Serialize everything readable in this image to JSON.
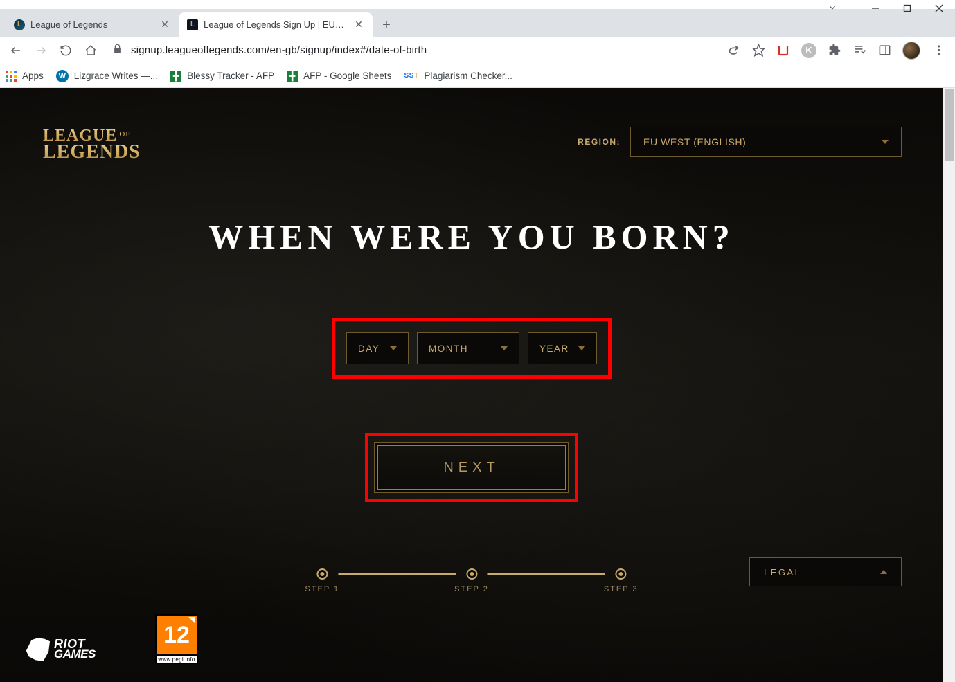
{
  "window": {
    "minimize": "–",
    "maximize": "□",
    "close": "✕",
    "caret": "⌄"
  },
  "tabs": {
    "items": [
      {
        "title": "League of Legends"
      },
      {
        "title": "League of Legends Sign Up | EU W"
      }
    ]
  },
  "address": {
    "url": "signup.leagueoflegends.com/en-gb/signup/index#/date-of-birth"
  },
  "bookmarks": {
    "apps": "Apps",
    "items": [
      {
        "label": "Lizgrace Writes —...",
        "icon": "wp"
      },
      {
        "label": "Blessy Tracker - AFP",
        "icon": "sheet"
      },
      {
        "label": "AFP - Google Sheets",
        "icon": "sheet"
      },
      {
        "label": "Plagiarism Checker...",
        "icon": "sst"
      }
    ]
  },
  "logo": {
    "line1": "LEAGUE",
    "of": "OF",
    "line2": "LEGENDS"
  },
  "region": {
    "label": "REGION:",
    "value": "EU WEST (ENGLISH)"
  },
  "headline": "WHEN WERE YOU BORN?",
  "dob": {
    "day": "DAY",
    "month": "MONTH",
    "year": "YEAR"
  },
  "next": "NEXT",
  "steps": {
    "s1": "STEP 1",
    "s2": "STEP 2",
    "s3": "STEP 3"
  },
  "legal": "LEGAL",
  "riot": {
    "line1": "RIOT",
    "line2": "GAMES"
  },
  "pegi": {
    "num": "12",
    "url": "www.pegi.info"
  }
}
